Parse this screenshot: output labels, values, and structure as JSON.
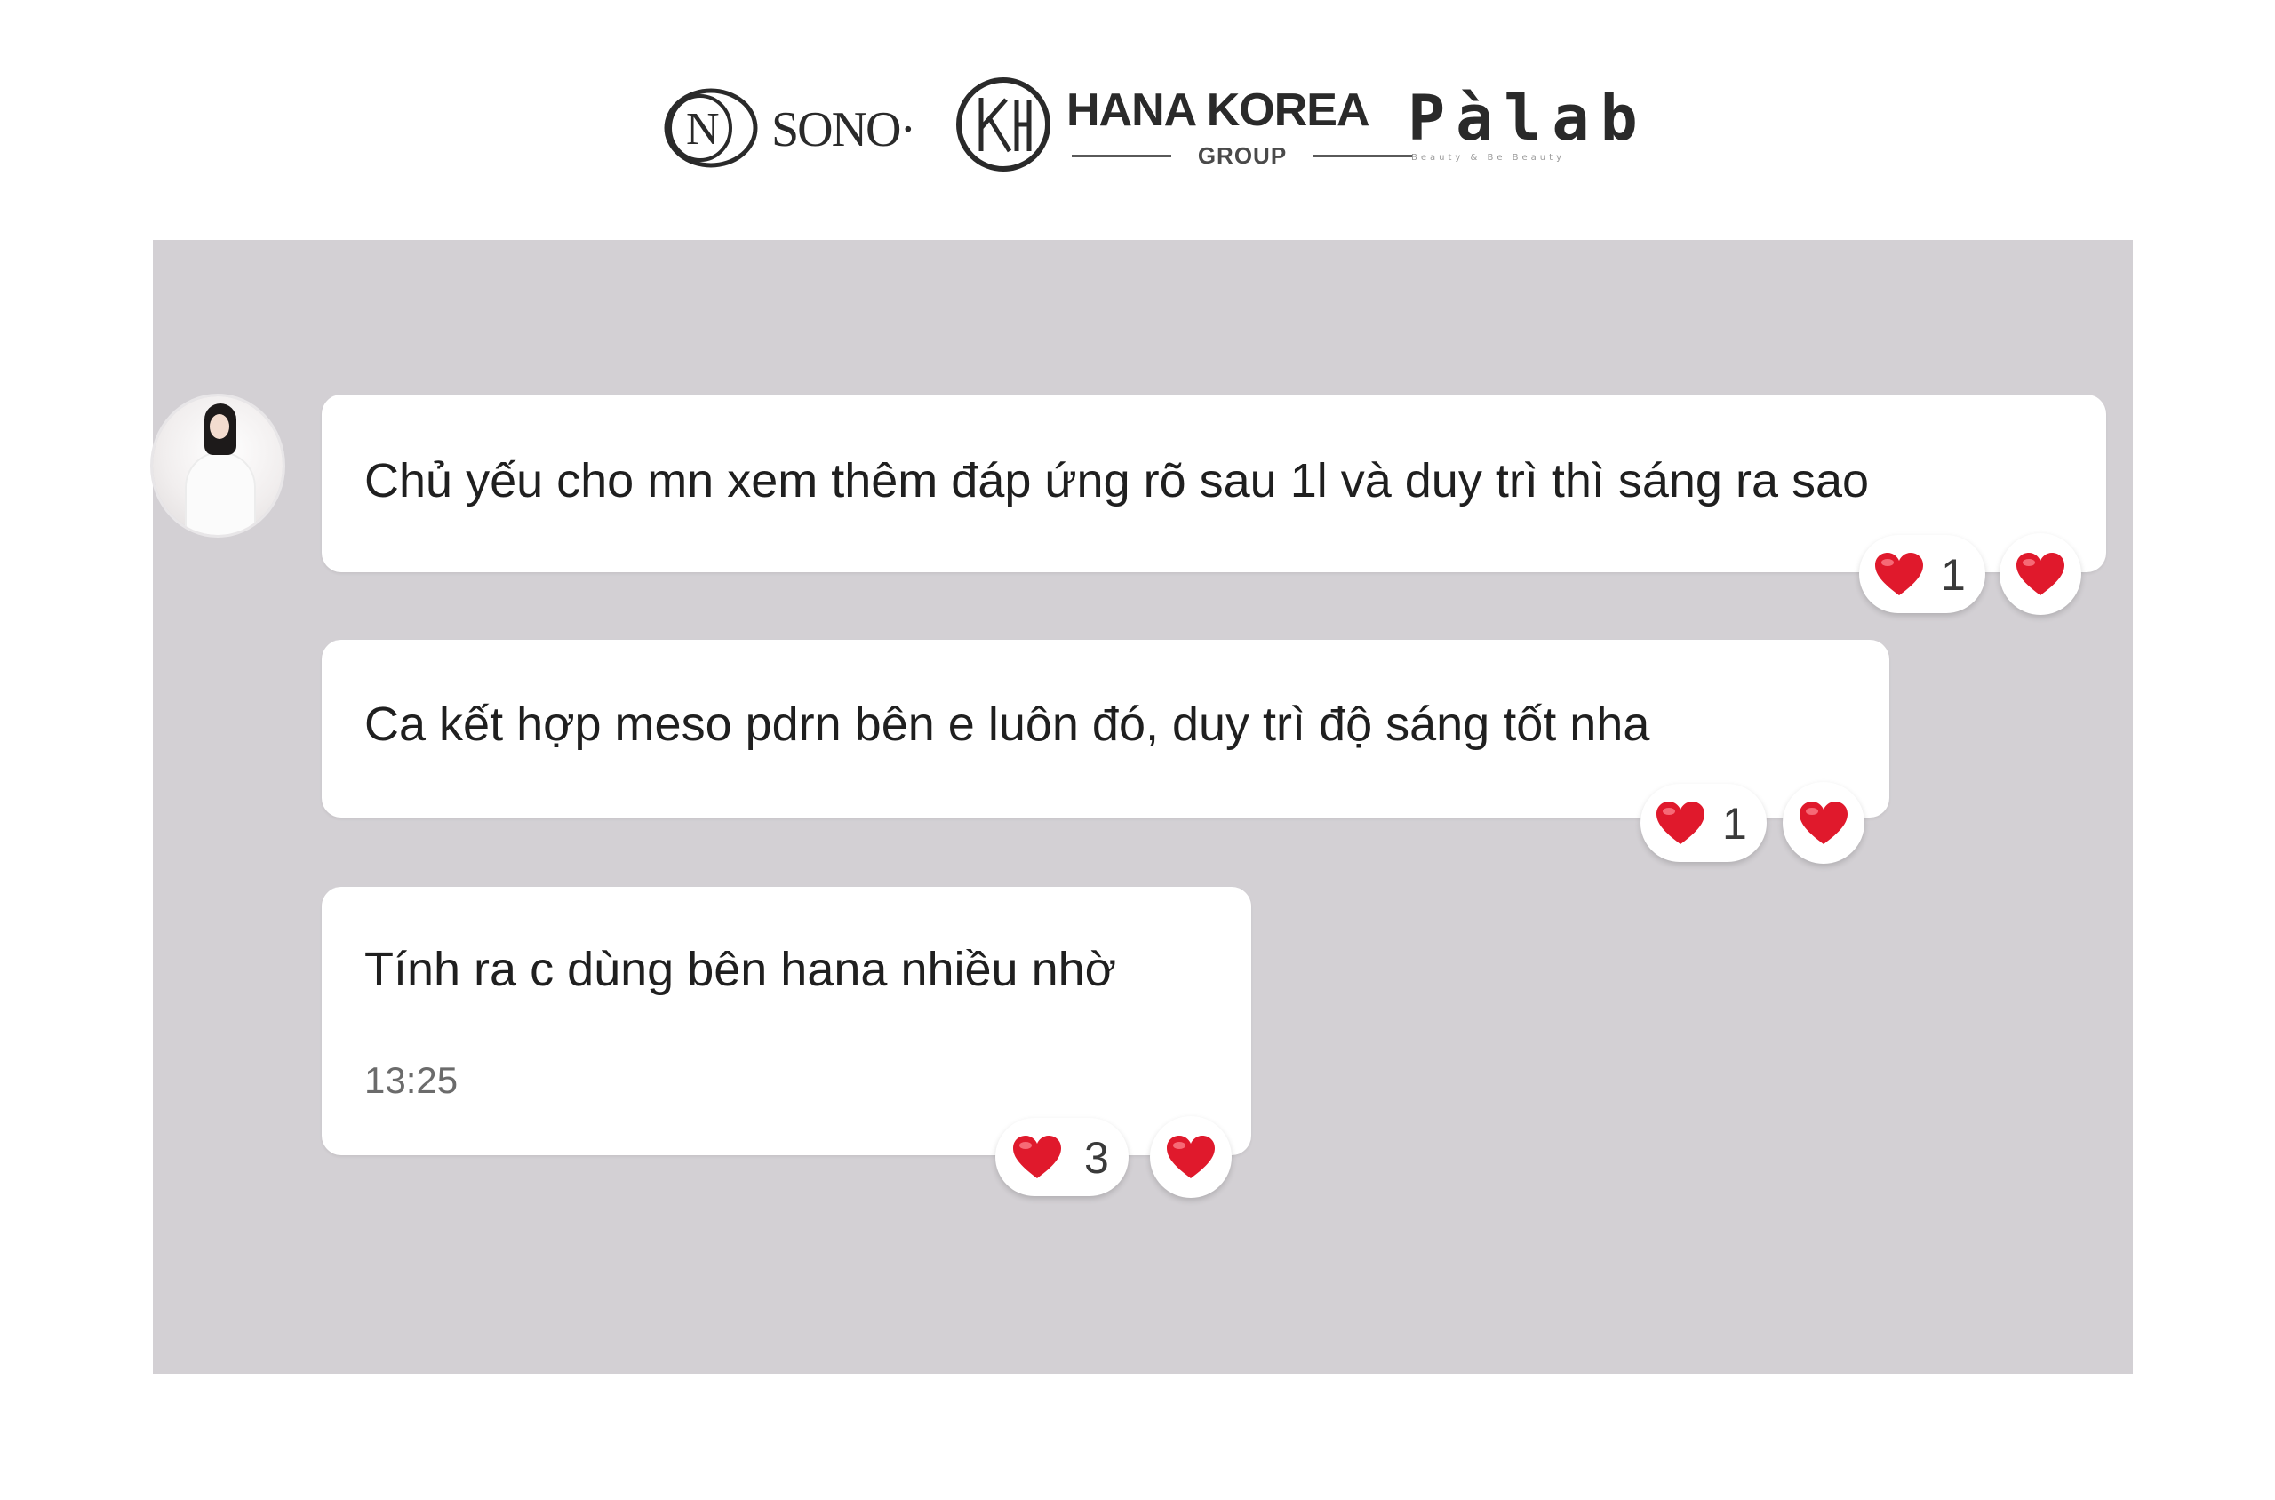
{
  "brands": {
    "sono": {
      "word": "SONO·",
      "monogram": "ON"
    },
    "hana_korea": {
      "word": "HANA KOREA",
      "sub": "GROUP",
      "monogram": "KH"
    },
    "palab": {
      "word": "Pàlab",
      "tagline": "Beauty & Be Beauty"
    }
  },
  "chat": {
    "background_color": "#d3d0d4",
    "messages": [
      {
        "text": "Chủ yếu cho mn xem thêm đáp ứng rõ sau 1l và duy trì thì sáng ra sao",
        "reaction_icon": "heart-icon",
        "reaction_count": "1"
      },
      {
        "text": "Ca kết hợp meso pdrn bên e luôn đó, duy trì độ sáng tốt nha",
        "reaction_icon": "heart-icon",
        "reaction_count": "1"
      },
      {
        "text": "Tính ra c dùng bên hana nhiều nhờ",
        "time": "13:25",
        "reaction_icon": "heart-icon",
        "reaction_count": "3"
      }
    ]
  },
  "colors": {
    "heart": "#e0192c",
    "bubble": "#ffffff",
    "text": "#1f1f1f"
  }
}
